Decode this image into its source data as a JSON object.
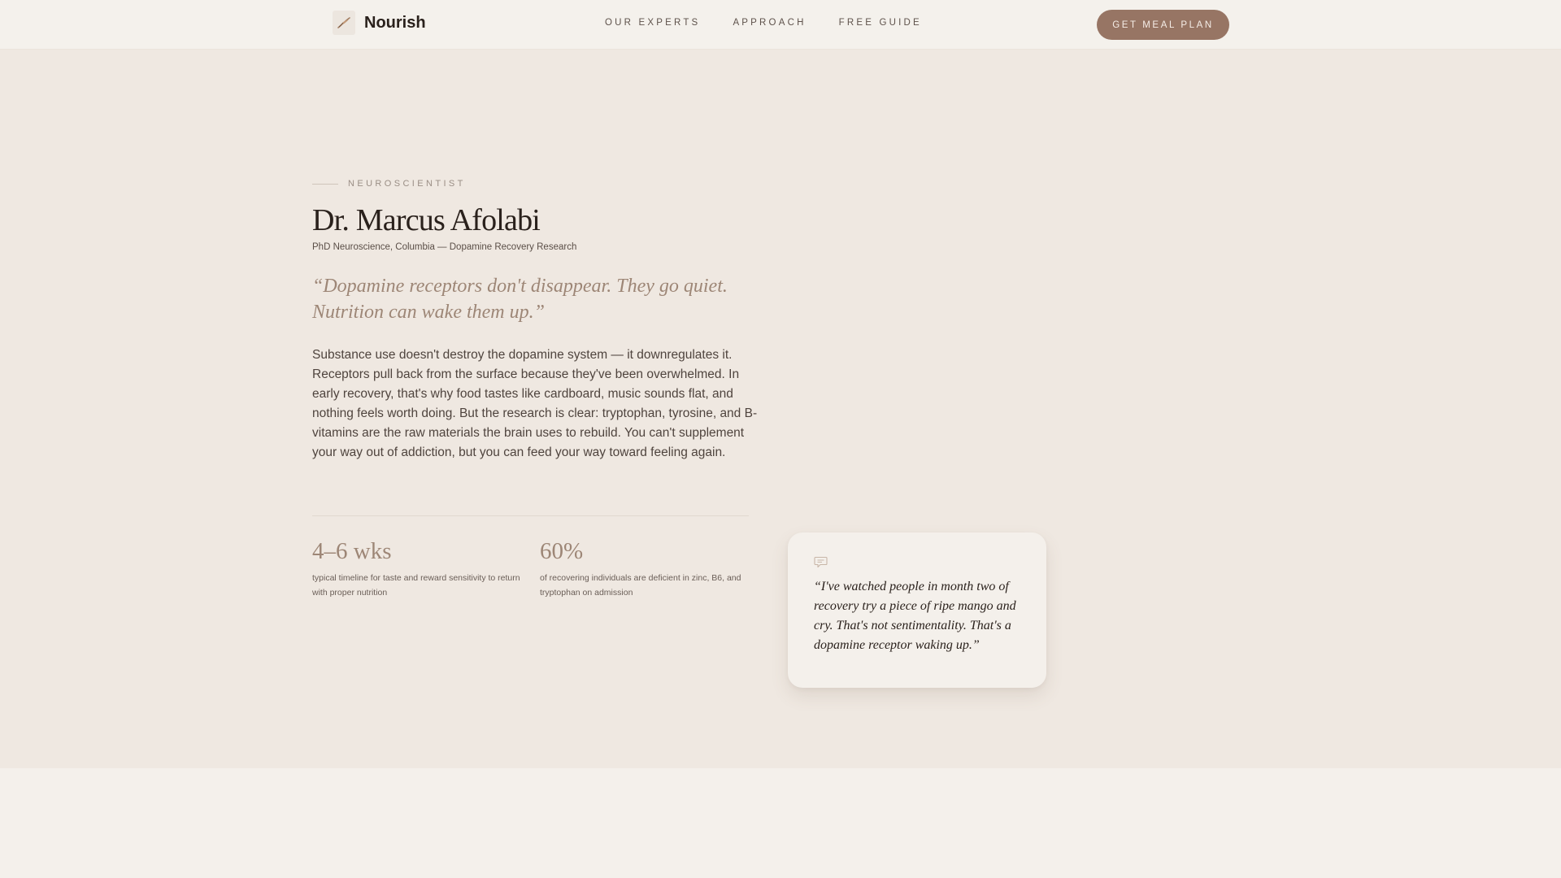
{
  "header": {
    "brand": "Nourish",
    "logo_icon": "leaf-icon",
    "nav": [
      "OUR EXPERTS",
      "APPROACH",
      "FREE GUIDE"
    ],
    "cta_label": "GET MEAL PLAN"
  },
  "expert": {
    "eyebrow": "NEUROSCIENTIST",
    "name": "Dr. Marcus Afolabi",
    "credentials": "PhD Neuroscience, Columbia — Dopamine Recovery Research",
    "pull_quote": "“Dopamine receptors don't disappear. They go quiet. Nutrition can wake them up.”",
    "body": "Substance use doesn't destroy the dopamine system — it downregulates it. Receptors pull back from the surface because they've been overwhelmed. In early recovery, that's why food tastes like cardboard, music sounds flat, and nothing feels worth doing. But the research is clear: tryptophan, tyrosine, and B-vitamins are the raw materials the brain uses to rebuild. You can't supplement your way out of addiction, but you can feed your way toward feeling again."
  },
  "stats": [
    {
      "value": "4–6 wks",
      "label": "typical timeline for taste and reward sensitivity to return with proper nutrition"
    },
    {
      "value": "60%",
      "label": "of recovering individuals are deficient in zinc, B6, and tryptophan on admission"
    }
  ],
  "testimonial": {
    "icon": "speech-bubble-icon",
    "quote": "“I've watched people in month two of recovery try a piece of ripe mango and cry. That's not sentimentality. That's a dopamine receptor waking up.”"
  },
  "colors": {
    "accent": "#977564",
    "quote_accent": "#9d8676",
    "hero_bg": "#efe8e1",
    "page_bg": "#f4f0eb"
  }
}
